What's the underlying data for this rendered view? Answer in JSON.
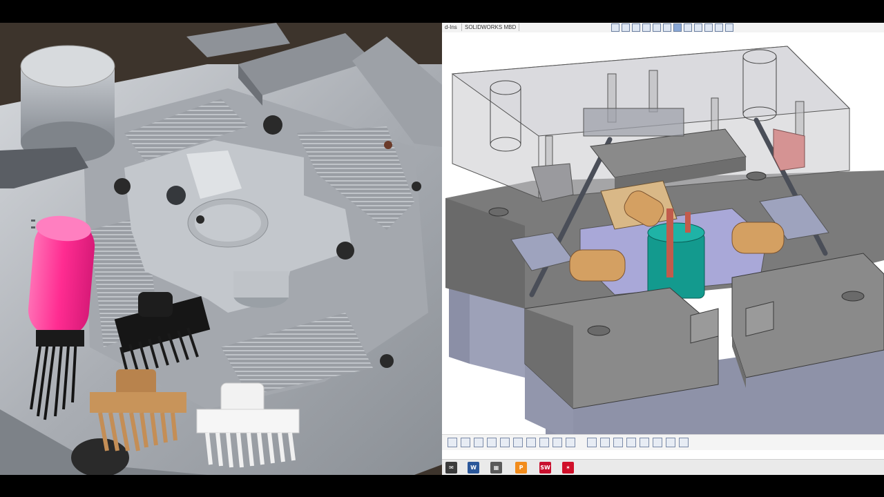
{
  "solidworks": {
    "tabs": [
      {
        "label": "d-Ins"
      },
      {
        "label": "SOLIDWORKS MBD"
      }
    ],
    "taskbar": {
      "sw_label": "SW",
      "word_label": "W",
      "powerpoint_label": "P"
    }
  },
  "colors": {
    "mold_steel": "#b8bcc2",
    "pink_handle": "#ff3f9e",
    "cad_plate": "#8a8a8a",
    "cad_core": "#139a8e",
    "cad_slider_insert": "#d4a062",
    "cad_transparent_plate": "#c8c8cc"
  }
}
